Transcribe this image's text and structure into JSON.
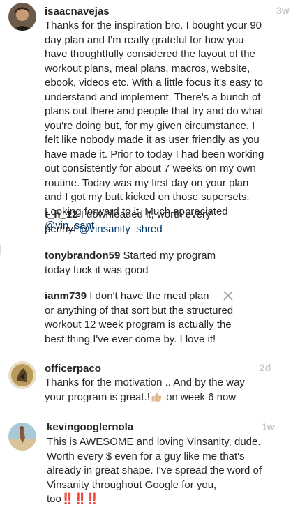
{
  "comments": [
    {
      "username": "isaacnavejas",
      "time": "3w",
      "lines": [
        "Thanks for the inspiration bro. I bought your 90",
        "day plan and I'm really grateful for how you",
        "have thoughtfully considered the layout of the",
        "workout plans, meal plans, macros, website,",
        "ebook, videos etc. With a little focus it's easy to",
        "understand and implement. There's a bunch of",
        "plans out there and people that try and do what",
        "you're doing but, for my given circumstance, I",
        "felt like nobody made it as user friendly as you",
        "have made it. Prior to today I had been working",
        "out consistently for about 7 weeks on my own",
        "routine. Today was my first day on your plan",
        "and I got my butt kicked on those supersets.",
        "Looking forward to it.  Much appreciated"
      ],
      "mention": "@vin_sant"
    },
    {
      "username": "officerpaco",
      "time": "2d",
      "line1": "Thanks for the motivation .. And by the way",
      "line2_before": "your program is great.!",
      "line2_after": " on week 6 now"
    },
    {
      "username": "kevingooglernola",
      "time": "1w",
      "lines": [
        "This is AWESOME and loving Vinsanity, dude.",
        "Worth every $ even for a guy like me that's",
        "already in great shape. I've spread the word of",
        "Vinsanity throughout Google for you,"
      ],
      "last_word": "too",
      "bangs": "‼️‼️‼️"
    }
  ],
  "replies": [
    {
      "username": "t_h_12",
      "text1": " I downloaded it, worth every",
      "text2_before": "penny! ",
      "mention": "@vinsanity_shred"
    },
    {
      "username": "tonybrandon59",
      "text1": " Started my program",
      "text2": "today fuck it was good"
    },
    {
      "username": "ianm739",
      "text1": " I don't have the meal plan",
      "text2": "or anything of that sort but the structured",
      "text3": "workout 12 week program is actually the",
      "text4": "best thing I've ever come by. I love it!"
    }
  ],
  "icons": {
    "close": "close-icon",
    "thumbs": "thumbs-up-emoji"
  },
  "colors": {
    "mention": "#003569",
    "username": "#262626",
    "time": "#c7c7c7",
    "bangs": "#e0245e"
  }
}
